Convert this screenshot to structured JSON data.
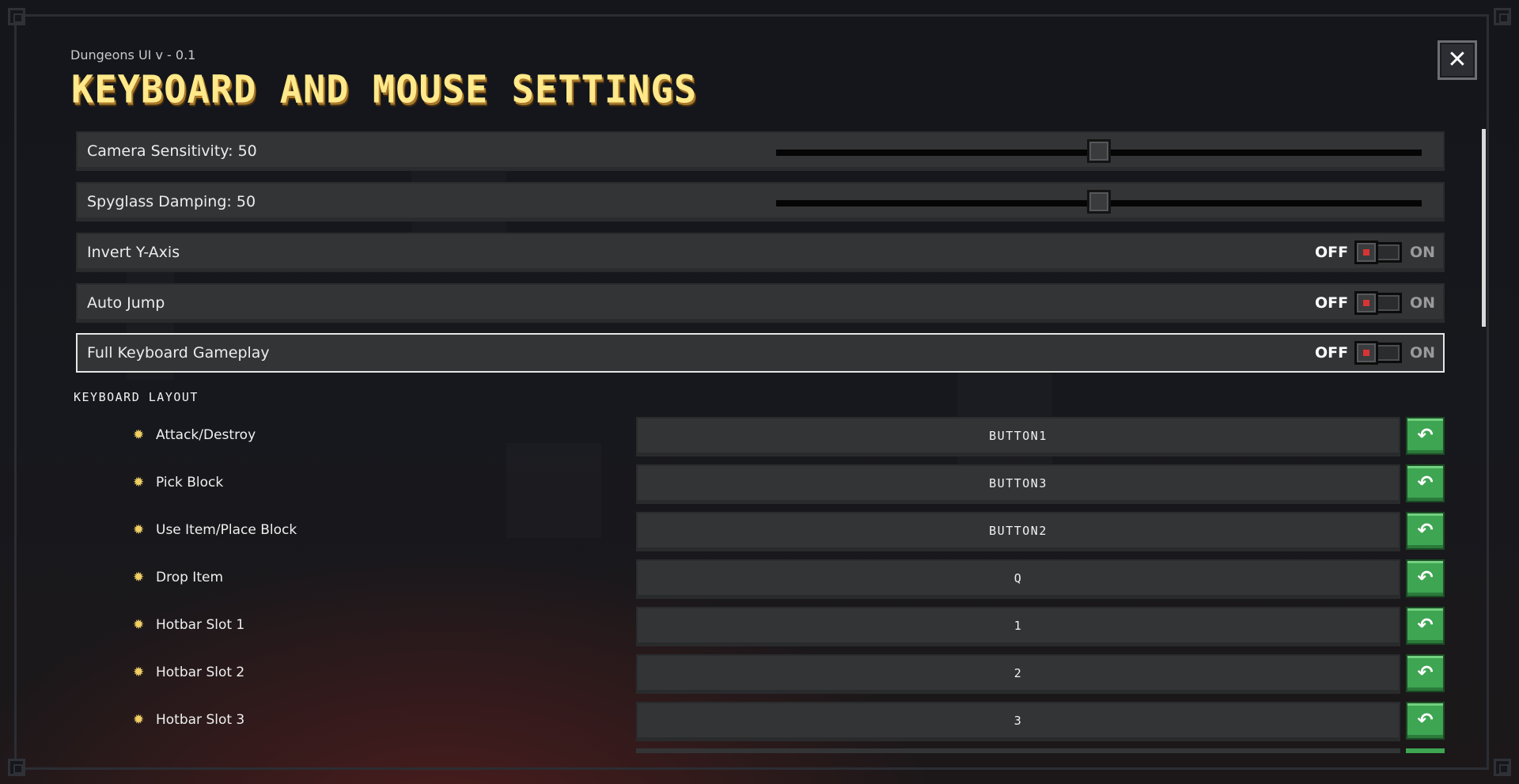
{
  "app": {
    "version": "Dungeons UI v - 0.1",
    "title": "Keyboard and Mouse Settings",
    "close_icon": "close-icon"
  },
  "colors": {
    "title": "#ffe98a",
    "accent_red": "#d83434",
    "reset_green": "#3ea552",
    "bullet": "#f0cf63"
  },
  "settings": [
    {
      "label": "Camera Sensitivity: 50",
      "type": "slider",
      "value": 50,
      "min": 0,
      "max": 100
    },
    {
      "label": "Spyglass Damping: 50",
      "type": "slider",
      "value": 50,
      "min": 0,
      "max": 100
    },
    {
      "label": "Invert Y-Axis",
      "type": "toggle",
      "off_label": "OFF",
      "on_label": "ON",
      "state": "OFF"
    },
    {
      "label": "Auto Jump",
      "type": "toggle",
      "off_label": "OFF",
      "on_label": "ON",
      "state": "OFF"
    },
    {
      "label": "Full Keyboard Gameplay",
      "type": "toggle",
      "off_label": "OFF",
      "on_label": "ON",
      "state": "OFF",
      "focused": true
    }
  ],
  "keyboard_layout": {
    "heading": "Keyboard Layout",
    "bullet_icon": "sparkle-icon",
    "reset_icon": "reset-icon",
    "bindings": [
      {
        "action": "Attack/Destroy",
        "key": "BUTTON1"
      },
      {
        "action": "Pick Block",
        "key": "BUTTON3"
      },
      {
        "action": "Use Item/Place Block",
        "key": "BUTTON2"
      },
      {
        "action": "Drop Item",
        "key": "Q"
      },
      {
        "action": "Hotbar Slot 1",
        "key": "1"
      },
      {
        "action": "Hotbar Slot 2",
        "key": "2"
      },
      {
        "action": "Hotbar Slot 3",
        "key": "3"
      }
    ]
  }
}
